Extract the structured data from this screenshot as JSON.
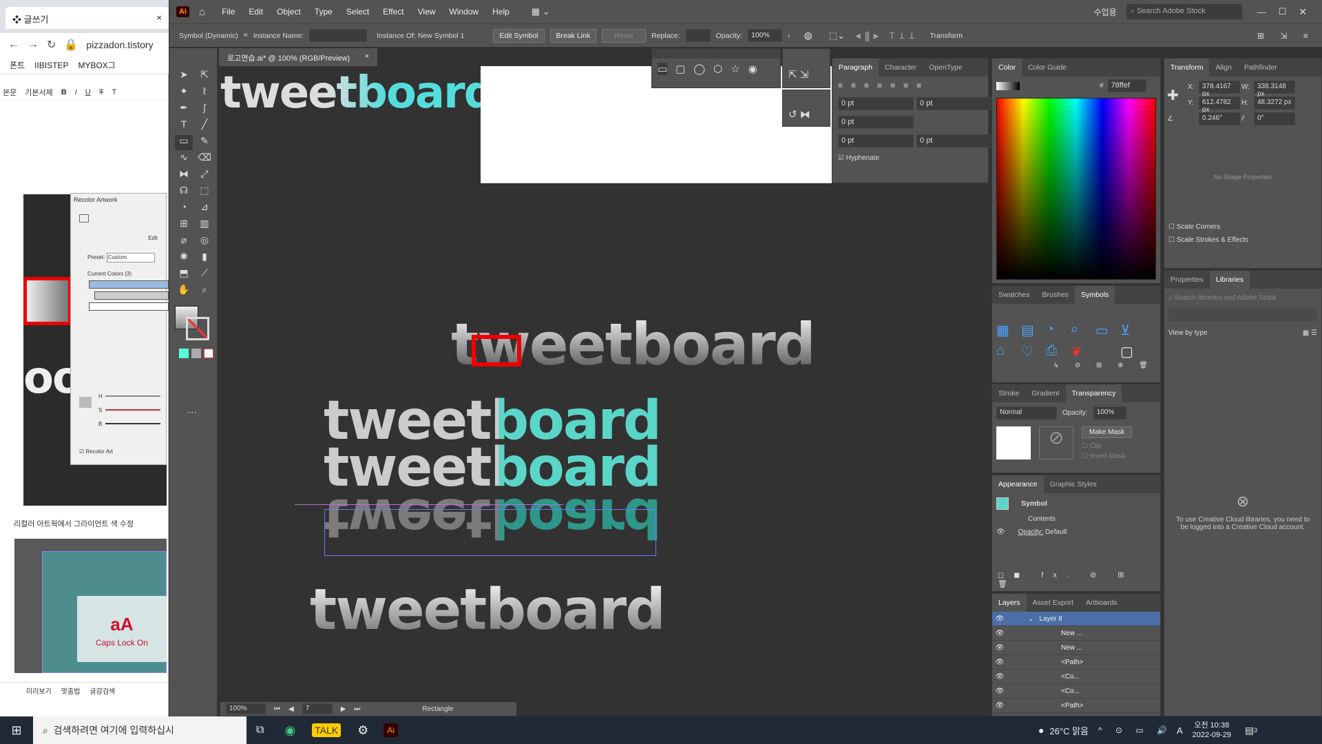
{
  "browser": {
    "tab_title": "글쓰기",
    "url": "pizzadon.tistory",
    "bookmarks": [
      "폰트",
      "IIBISTEP",
      "MYBOX그"
    ],
    "editor_labels": [
      "본문",
      "기본서체",
      "B",
      "I",
      "U",
      "T",
      "T"
    ],
    "recolor": {
      "title": "Recolor Artwork",
      "edit": "Edit",
      "preset_label": "Preset:",
      "preset_value": "Custom",
      "current_colors": "Current Colors (3)",
      "h": "H",
      "s": "S",
      "b": "B",
      "recolor_art": "Recolor Art"
    },
    "caption": "리컬러 아트웍에서 그라이언트 색 수정",
    "caps_big": "aA",
    "caps_small": "Caps Lock On",
    "footer": [
      "미리보기",
      "맞춤법",
      "글감검색"
    ]
  },
  "app": {
    "logo": "Ai",
    "menus": [
      "File",
      "Edit",
      "Object",
      "Type",
      "Select",
      "Effect",
      "View",
      "Window",
      "Help"
    ],
    "workspace": "수업용",
    "search_placeholder": "Search Adobe Stock"
  },
  "control": {
    "object_type": "Symbol (Dynamic)",
    "instance_name_label": "Instance Name:",
    "instance_of": "Instance Of: New Symbol 1",
    "edit_symbol": "Edit Symbol",
    "break_link": "Break Link",
    "reset": "Reset",
    "replace_label": "Replace:",
    "opacity_label": "Opacity:",
    "opacity_value": "100%",
    "transform": "Transform"
  },
  "document": {
    "tab": "로고연습.ai* @ 100% (RGB/Preview)",
    "zoom": "100%",
    "artboard_num": "7",
    "status_text": "Rectangle",
    "logo_text": "tweetboard"
  },
  "paragraph": {
    "tabs": [
      "Paragraph",
      "Character",
      "OpenType"
    ],
    "values": [
      "0 pt",
      "0 pt",
      "0 pt",
      "0 pt",
      "0 pt"
    ],
    "hyphenate": "Hyphenate"
  },
  "color": {
    "tabs": [
      "Color",
      "Color Guide"
    ],
    "hex": "78ffef"
  },
  "transform": {
    "tabs": [
      "Transform",
      "Align",
      "Pathfinder"
    ],
    "x_label": "X:",
    "x": "378.4167 px",
    "w_label": "W:",
    "w": "338.3148 px",
    "y_label": "Y:",
    "y": "612.4782 px",
    "h_label": "H:",
    "h": "48.3272 px",
    "angle": "0.246°",
    "shear": "0°",
    "no_shape": "No Shape Properties",
    "scale_corners": "Scale Corners",
    "scale_strokes": "Scale Strokes & Effects"
  },
  "libraries": {
    "tabs": [
      "Properties",
      "Libraries"
    ],
    "search_placeholder": "Search libraries and Adobe Stock",
    "view_by": "View by type",
    "login_msg": "To use Creative Cloud libraries, you need to be logged into a Creative Cloud account."
  },
  "symbols": {
    "tabs": [
      "Swatches",
      "Brushes",
      "Symbols"
    ]
  },
  "transparency": {
    "tabs": [
      "Stroke",
      "Gradient",
      "Transparency"
    ],
    "mode": "Normal",
    "opacity_label": "Opacity:",
    "opacity": "100%",
    "make_mask": "Make Mask",
    "clip": "Clip",
    "invert": "Invert Mask"
  },
  "appearance": {
    "tabs": [
      "Appearance",
      "Graphic Styles"
    ],
    "title": "Symbol",
    "contents": "Contents",
    "opacity_label": "Opacity:",
    "opacity_value": "Default"
  },
  "layers": {
    "tabs": [
      "Layers",
      "Asset Export",
      "Artboards"
    ],
    "rows": [
      "Layer 8",
      "New ...",
      "New ...",
      "<Path>",
      "<Co...",
      "<Co...",
      "<Path>"
    ]
  },
  "taskbar": {
    "search": "검색하려면 여기에 입력하십시",
    "weather": "26°C 맑음",
    "time": "오전 10:38",
    "date": "2022-09-29",
    "badge": "3",
    "ime": "A"
  }
}
